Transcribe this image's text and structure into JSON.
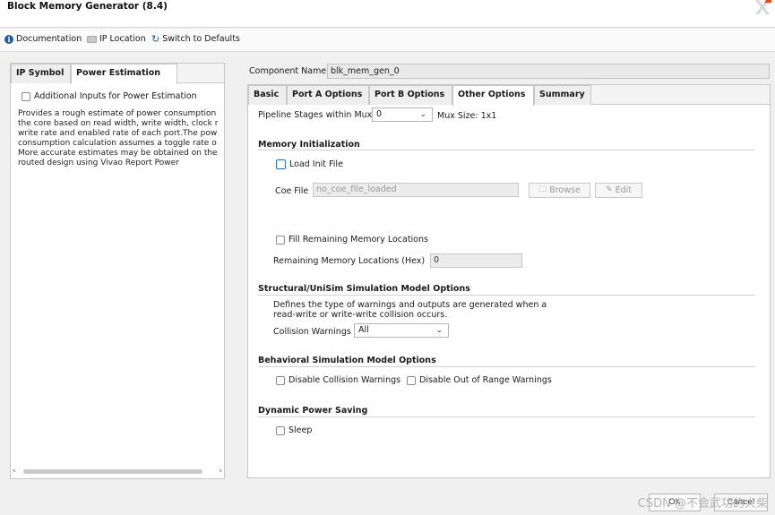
{
  "window": {
    "title": "Block Memory Generator (8.4)"
  },
  "toolbar": {
    "documentation": "Documentation",
    "ip_location": "IP Location",
    "switch_defaults": "Switch to Defaults"
  },
  "left_panel": {
    "tabs": [
      "IP Symbol",
      "Power Estimation"
    ],
    "active_tab": "Power Estimation",
    "checkbox_label": "Additional Inputs for Power Estimation",
    "checkbox_checked": false,
    "description": "Provides a rough estimate of power consumption\nthe core based on read width, write width, clock r\nwrite rate and enabled rate of each port.The pow\nconsumption calculation assumes a toggle rate o\nMore accurate estimates may be obtained on the\nrouted design using Vivao Report Power"
  },
  "component": {
    "label": "Component Name",
    "value": "blk_mem_gen_0"
  },
  "right_panel": {
    "tabs": [
      "Basic",
      "Port A Options",
      "Port B Options",
      "Other Options",
      "Summary"
    ],
    "active_tab": "Other Options",
    "pipeline": {
      "label": "Pipeline Stages within Mux",
      "value": "0",
      "mux_size": "Mux Size: 1x1"
    },
    "memory_init": {
      "title": "Memory Initialization",
      "load_init_label": "Load Init File",
      "load_init_checked": false,
      "coe_label": "Coe File",
      "coe_value": "no_coe_file_loaded",
      "browse": "Browse",
      "edit": "Edit",
      "fill_label": "Fill Remaining Memory Locations",
      "fill_checked": false,
      "remaining_label": "Remaining Memory Locations (Hex)",
      "remaining_value": "0"
    },
    "structural": {
      "title": "Structural/UniSim Simulation Model Options",
      "desc_line1": "Defines the type of warnings and outputs are generated when a",
      "desc_line2": "read-write or write-write collision occurs.",
      "collision_label": "Collision Warnings",
      "collision_value": "All"
    },
    "behavioral": {
      "title": "Behavioral Simulation Model Options",
      "disable_collision": "Disable Collision Warnings",
      "disable_range": "Disable Out of Range Warnings"
    },
    "power": {
      "title": "Dynamic Power Saving",
      "sleep": "Sleep"
    }
  },
  "footer": {
    "ok": "OK",
    "cancel": "Cancel",
    "watermark": "CSDN @不会武功的火柴"
  },
  "colors": {
    "accent": "#1f5ca8",
    "tab_border": "#c7c7c7"
  }
}
